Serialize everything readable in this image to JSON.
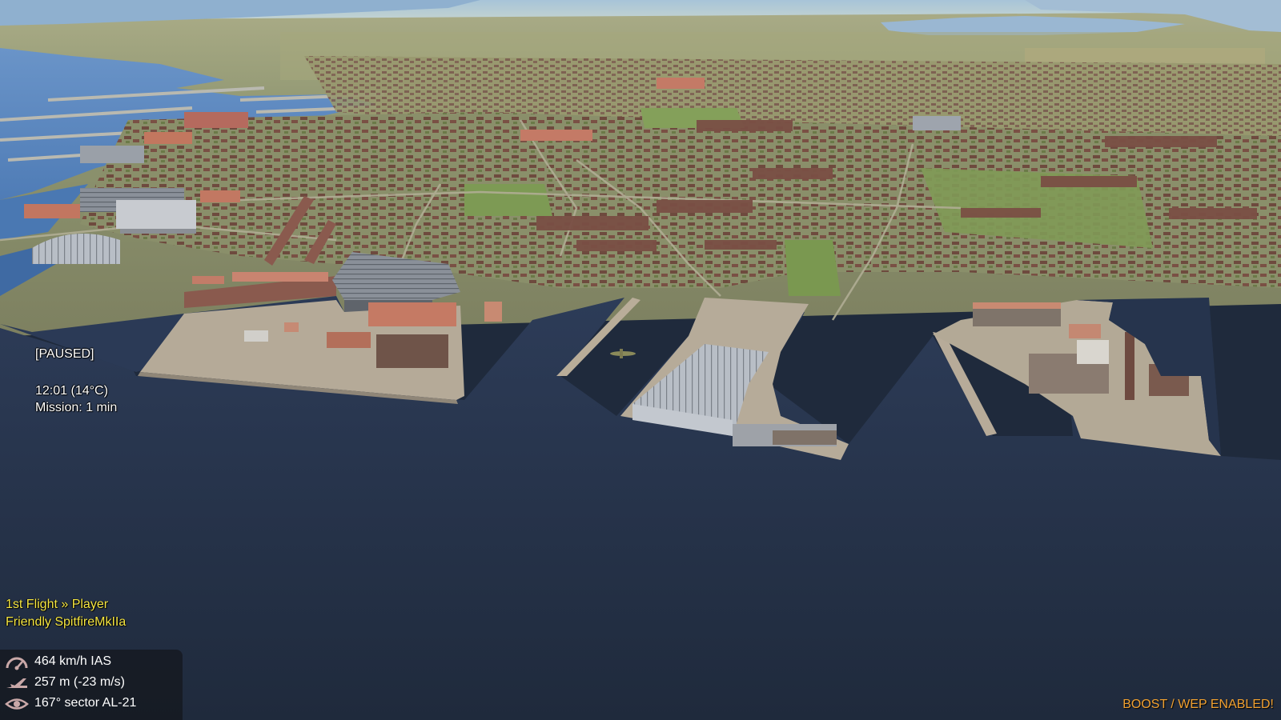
{
  "hud": {
    "status": "[PAUSED]",
    "time": "12:01 (14°C)",
    "mission": "Mission: 1 min"
  },
  "flight": {
    "group": "1st Flight » Player",
    "aircraft": "Friendly SpitfireMkIIa"
  },
  "instruments": {
    "speed": "464 km/h IAS",
    "altitude": "257 m (-23 m/s)",
    "heading": "167° sector AL-21"
  },
  "alerts": {
    "boost": "BOOST / WEP ENABLED!"
  },
  "colors": {
    "sea": "#1f2a3c",
    "land": "#8b9468",
    "flight_text": "#f5e642",
    "boost_text": "#f0a030",
    "panel_bg": "#14161c"
  }
}
